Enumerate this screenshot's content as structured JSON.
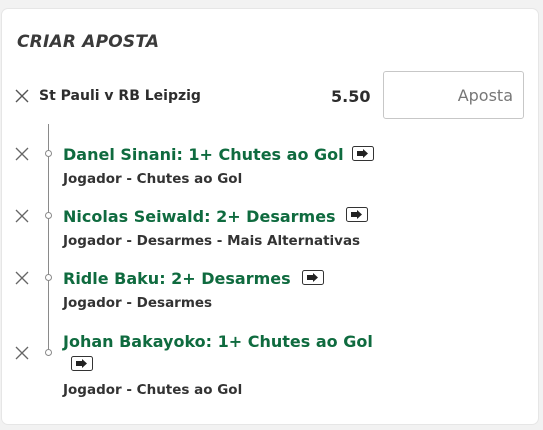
{
  "header": {
    "title": "CRIAR APOSTA"
  },
  "bet": {
    "match": "St Pauli v RB Leipzig",
    "odds": "5.50",
    "stake_placeholder": "Aposta",
    "stake_value": ""
  },
  "selections": [
    {
      "name": "Danel Sinani: 1+ Chutes ao Gol",
      "market": "Jogador - Chutes ao Gol"
    },
    {
      "name": "Nicolas Seiwald: 2+ Desarmes",
      "market": "Jogador - Desarmes - Mais Alternativas"
    },
    {
      "name": "Ridle Baku: 2+ Desarmes",
      "market": "Jogador - Desarmes"
    },
    {
      "name": "Johan Bakayoko: 1+ Chutes ao Gol",
      "market": "Jogador - Chutes ao Gol"
    }
  ],
  "icons": {
    "remove": "close-icon",
    "bet_builder": "bet-builder-icon"
  },
  "colors": {
    "selection_text": "#0f6b3f",
    "text": "#2d2d2d",
    "border": "#c7c7c7"
  }
}
